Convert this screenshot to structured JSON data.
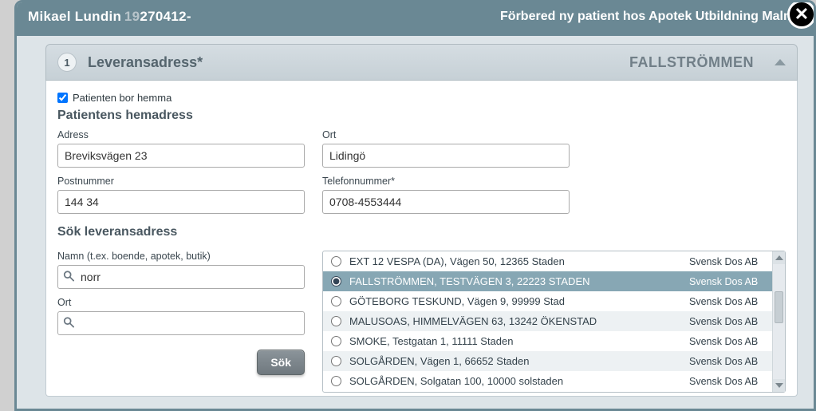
{
  "header": {
    "patient_name": "Mikael Lundin",
    "pnr_prefix": "19",
    "pnr_rest": "270412-",
    "subtitle_right": "Förbered ny patient hos Apotek Utbildning Malmö"
  },
  "accordion": {
    "step_num": "1",
    "title": "Leveransadress*",
    "right_label": "FALLSTRÖMMEN"
  },
  "home": {
    "checkbox_label": "Patienten bor hemma",
    "section_title": "Patientens hemadress",
    "fields": {
      "adress_label": "Adress",
      "adress_value": "Breviksvägen 23",
      "ort_label": "Ort",
      "ort_value": "Lidingö",
      "postnummer_label": "Postnummer",
      "postnummer_value": "144 34",
      "telefon_label": "Telefonnummer*",
      "telefon_value": "0708-4553444"
    }
  },
  "search": {
    "section_title": "Sök leveransadress",
    "name_label": "Namn (t.ex. boende, apotek, butik)",
    "name_value": "norr",
    "ort_label": "Ort",
    "ort_value": "",
    "button_label": "Sök"
  },
  "results": [
    {
      "label": "EXT 12 VESPA (DA), Vägen 50, 12365 Staden",
      "supplier": "Svensk Dos AB",
      "selected": false
    },
    {
      "label": "FALLSTRÖMMEN, TESTVÄGEN 3, 22223 STADEN",
      "supplier": "Svensk Dos AB",
      "selected": true
    },
    {
      "label": "GÖTEBORG TESKUND, Vägen 9, 99999 Stad",
      "supplier": "Svensk Dos AB",
      "selected": false
    },
    {
      "label": "MALUSOAS, HIMMELVÄGEN 63, 13242 ÖKENSTAD",
      "supplier": "Svensk Dos AB",
      "selected": false
    },
    {
      "label": "SMOKE, Testgatan 1, 11111 Staden",
      "supplier": "Svensk Dos AB",
      "selected": false
    },
    {
      "label": "SOLGÅRDEN, Vägen 1, 66652 Staden",
      "supplier": "Svensk Dos AB",
      "selected": false
    },
    {
      "label": "SOLGÅRDEN, Solgatan 100, 10000 solstaden",
      "supplier": "Svensk Dos AB",
      "selected": false
    }
  ]
}
